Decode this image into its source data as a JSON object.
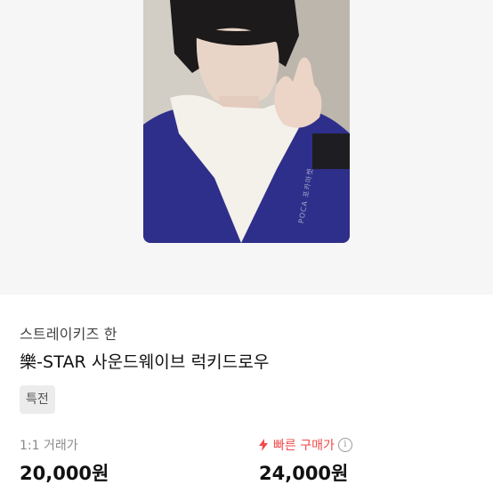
{
  "listing": {
    "artist": "스트레이키즈 한",
    "title": "樂-STAR 사운드웨이브 럭키드로우",
    "tag": "특전",
    "watermark": "POCA 포카마켓"
  },
  "prices": {
    "trade_label": "1:1 거래가",
    "trade_price": "20,000원",
    "quick_label": "빠른 구매가",
    "quick_price": "24,000원",
    "info_glyph": "i"
  },
  "colors": {
    "accent_red": "#f04a4a",
    "background_gray": "#f6f6f6"
  }
}
